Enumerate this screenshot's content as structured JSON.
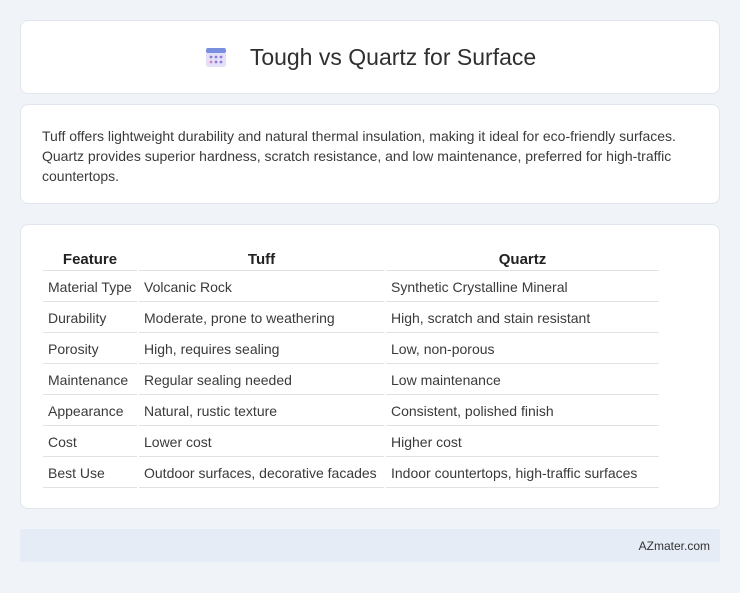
{
  "header": {
    "title": "Tough vs Quartz for Surface",
    "icon": "calendar-icon"
  },
  "summary": {
    "text": "Tuff offers lightweight durability and natural thermal insulation, making it ideal for eco-friendly surfaces. Quartz provides superior hardness, scratch resistance, and low maintenance, preferred for high-traffic countertops."
  },
  "table": {
    "headers": [
      "Feature",
      "Tuff",
      "Quartz"
    ],
    "rows": [
      [
        "Material Type",
        "Volcanic Rock",
        "Synthetic Crystalline Mineral"
      ],
      [
        "Durability",
        "Moderate, prone to weathering",
        "High, scratch and stain resistant"
      ],
      [
        "Porosity",
        "High, requires sealing",
        "Low, non-porous"
      ],
      [
        "Maintenance",
        "Regular sealing needed",
        "Low maintenance"
      ],
      [
        "Appearance",
        "Natural, rustic texture",
        "Consistent, polished finish"
      ],
      [
        "Cost",
        "Lower cost",
        "Higher cost"
      ],
      [
        "Best Use",
        "Outdoor surfaces, decorative facades",
        "Indoor countertops, high-traffic surfaces"
      ]
    ]
  },
  "footer": {
    "text": "AZmater.com"
  }
}
